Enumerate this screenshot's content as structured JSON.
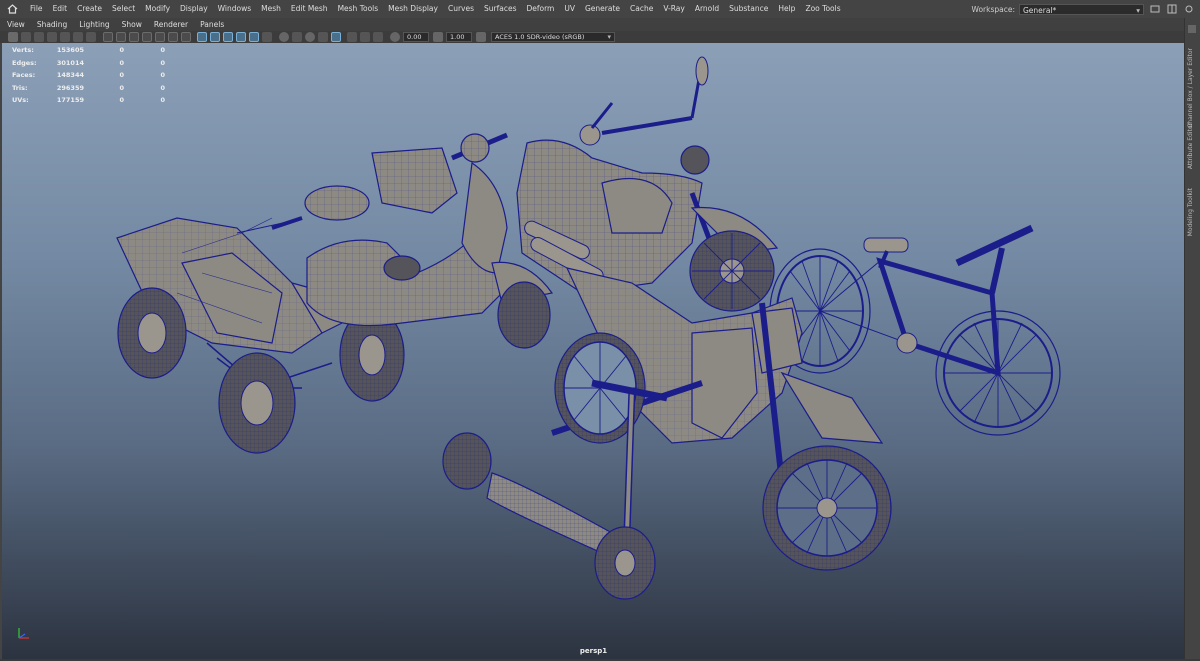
{
  "menubar": {
    "items": [
      "File",
      "Edit",
      "Create",
      "Select",
      "Modify",
      "Display",
      "Windows",
      "Mesh",
      "Edit Mesh",
      "Mesh Tools",
      "Mesh Display",
      "Curves",
      "Surfaces",
      "Deform",
      "UV",
      "Generate",
      "Cache",
      "V-Ray",
      "Arnold",
      "Substance",
      "Help",
      "Zoo Tools"
    ],
    "workspace_label": "Workspace:",
    "workspace_value": "General*"
  },
  "panel_menu": {
    "items": [
      "View",
      "Shading",
      "Lighting",
      "Show",
      "Renderer",
      "Panels"
    ]
  },
  "toolbar": {
    "exposure": "0.00",
    "gamma": "1.00",
    "color_space": "ACES 1.0 SDR-video (sRGB)"
  },
  "hud": {
    "rows": [
      {
        "label": "Verts:",
        "v1": "153605",
        "v2": "0",
        "v3": "0"
      },
      {
        "label": "Edges:",
        "v1": "301014",
        "v2": "0",
        "v3": "0"
      },
      {
        "label": "Faces:",
        "v1": "148344",
        "v2": "0",
        "v3": "0"
      },
      {
        "label": "Tris:",
        "v1": "296359",
        "v2": "0",
        "v3": "0"
      },
      {
        "label": "UVs:",
        "v1": "177159",
        "v2": "0",
        "v3": "0"
      }
    ]
  },
  "viewport": {
    "camera": "persp1"
  },
  "sidebar": {
    "tabs": [
      "Channel Box / Layer Editor",
      "Attribute Editor",
      "Modeling Toolkit"
    ]
  },
  "colors": {
    "wire": "#1b1d8a",
    "mesh": "#8d8a84",
    "bg_top": "#8b9fb7",
    "bg_bottom": "#2c3340"
  }
}
